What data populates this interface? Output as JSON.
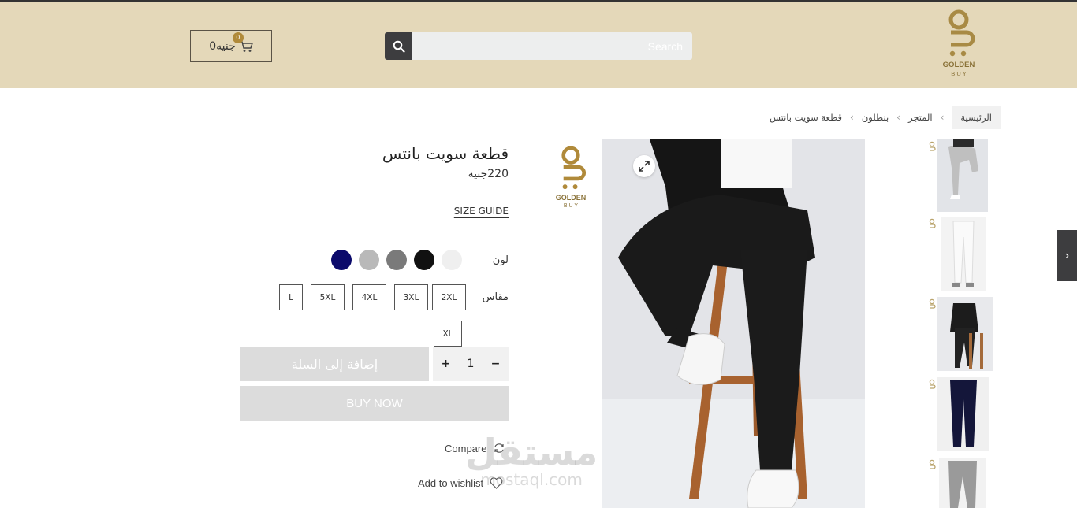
{
  "header": {
    "cart": {
      "amount": "0جنيه",
      "count": "0"
    },
    "search": {
      "placeholder": "Search"
    },
    "logo": {
      "line1": "GOLDEN",
      "line2": "B U Y"
    }
  },
  "breadcrumb": {
    "home": "الرئيسية",
    "shop": "المتجر",
    "category": "بنطلون",
    "current": "قطعة سويت بانتس"
  },
  "product": {
    "title": "قطعة سويت بانتس",
    "price": "220جنيه",
    "size_guide": "SIZE GUIDE",
    "color_label": "لون",
    "size_label": "مقاس",
    "colors": [
      "#efefef",
      "#111111",
      "#7a7a7a",
      "#b9b9b9",
      "#0b0a6b"
    ],
    "sizes": [
      "2XL",
      "3XL",
      "4XL",
      "5XL",
      "L",
      "XL"
    ],
    "quantity": "1",
    "add_to_cart": "إضافة إلى السلة",
    "buy_now": "BUY NOW",
    "compare": "Compare",
    "wishlist": "Add to wishlist"
  },
  "brand_logo": {
    "line1": "GOLDEN",
    "line2": "B U Y"
  },
  "watermark": {
    "arabic": "مستقل",
    "latin": "mostaql.com"
  },
  "colors": {
    "header_bg": "#e4d8b9",
    "gold": "#b08a3a",
    "dark": "#3d3d3f",
    "disabled": "#dcdcdc"
  }
}
